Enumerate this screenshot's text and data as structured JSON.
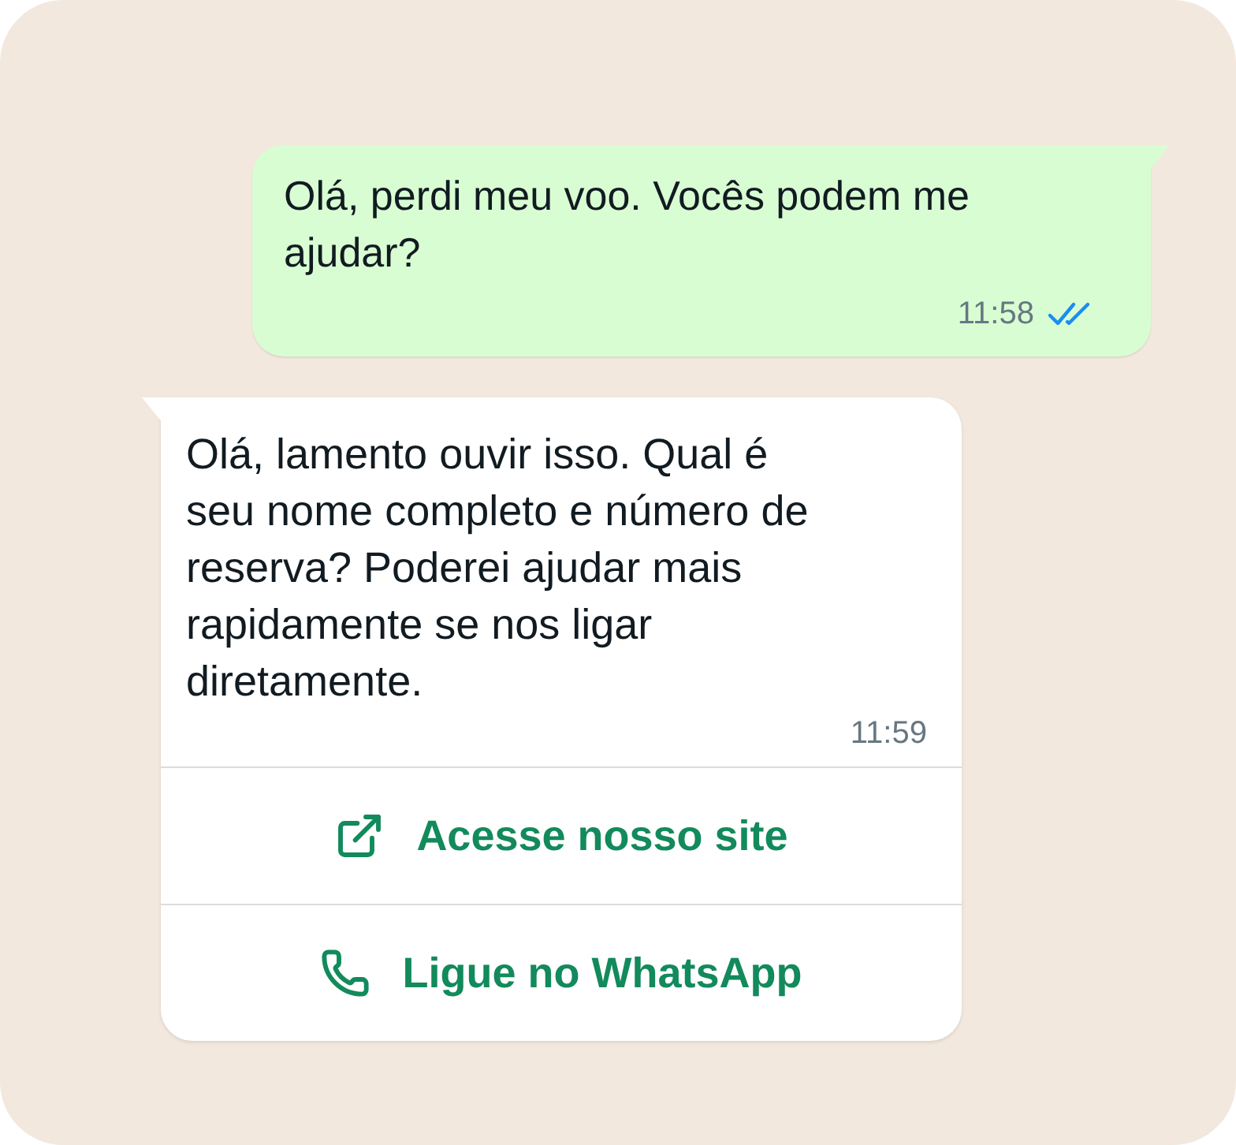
{
  "messages": [
    {
      "kind": "outgoing",
      "text": "Olá, perdi meu voo. Vocês podem me ajudar?",
      "time": "11:58",
      "read": true
    },
    {
      "kind": "incoming",
      "text": "Olá, lamento ouvir isso. Qual é seu nome completo e número de reserva? Poderei ajudar mais rapidamente se nos ligar diretamente.",
      "time": "11:59",
      "buttons": [
        {
          "kind": "link",
          "label": "Acesse nosso site"
        },
        {
          "kind": "call",
          "label": "Ligue no WhatsApp"
        }
      ]
    }
  ]
}
